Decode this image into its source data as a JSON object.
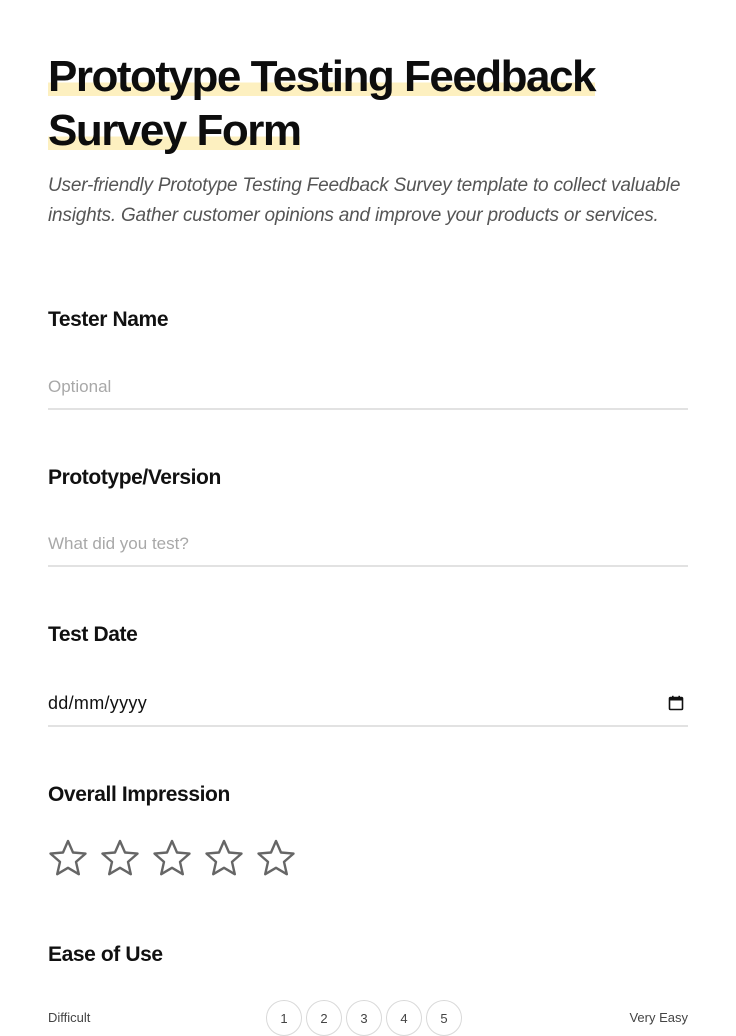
{
  "form": {
    "title": "Prototype Testing Feedback Survey Form",
    "title_line1": "Prototype Testing Feedback",
    "title_line2": "Survey Form",
    "description": "User-friendly Prototype Testing Feedback Survey template to collect valuable insights. Gather customer opinions and improve your products or services."
  },
  "fields": {
    "tester_name": {
      "label": "Tester Name",
      "placeholder": "Optional",
      "value": ""
    },
    "prototype_version": {
      "label": "Prototype/Version",
      "placeholder": "What did you test?",
      "value": ""
    },
    "test_date": {
      "label": "Test Date",
      "placeholder": "dd/mm/yyyy",
      "icon": "calendar-icon"
    },
    "overall_impression": {
      "label": "Overall Impression",
      "rating": 0,
      "max": 5,
      "icon": "star-icon"
    },
    "ease_of_use": {
      "label": "Ease of Use",
      "low_label": "Difficult",
      "high_label": "Very Easy",
      "options": [
        "1",
        "2",
        "3",
        "4",
        "5"
      ]
    }
  },
  "colors": {
    "title_highlight": "#fdf0c0",
    "text": "#111111",
    "placeholder": "#a8a8a8",
    "star_outline": "#666666"
  }
}
